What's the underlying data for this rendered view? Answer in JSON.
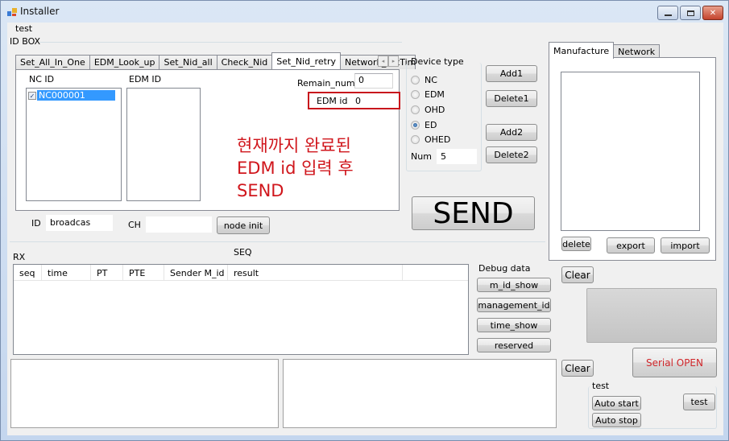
{
  "window": {
    "title": "Installer",
    "controls": {
      "minimize": "—",
      "maximize": "□",
      "close": "✕"
    }
  },
  "menu": {
    "test": "test"
  },
  "id_box": {
    "label": "ID BOX",
    "tabs": [
      {
        "label": "Set_All_In_One"
      },
      {
        "label": "EDM_Look_up"
      },
      {
        "label": "Set_Nid_all"
      },
      {
        "label": "Check_Nid"
      },
      {
        "label": "Set_Nid_retry",
        "active": true
      },
      {
        "label": "Network_setTime"
      }
    ],
    "tab_scroll": {
      "left": "◂",
      "right": "▸"
    },
    "nc_id_label": "NC ID",
    "edm_id_label": "EDM ID",
    "nc_list": [
      {
        "label": "NC000001",
        "checked": true,
        "selected": true
      }
    ],
    "edm_list": [],
    "remain_num_label": "Remain_num",
    "remain_num_value": "0",
    "edm_id_field_label": "EDM id",
    "edm_id_value": "0",
    "annotation": "현재까지 완료된 EDM id 입력 후 SEND",
    "annotation_lines": [
      "현재까지 완료된",
      "EDM id 입력 후",
      "SEND"
    ],
    "annotation_color": "#d0161c",
    "id_label": "ID",
    "id_value": "broadcas",
    "ch_label": "CH",
    "ch_value": "",
    "node_init": "node init"
  },
  "device_type": {
    "label": "Device type",
    "options": [
      {
        "label": "NC",
        "selected": false
      },
      {
        "label": "EDM",
        "selected": false
      },
      {
        "label": "OHD",
        "selected": false
      },
      {
        "label": "ED",
        "selected": true
      },
      {
        "label": "OHED",
        "selected": false
      }
    ],
    "num_label": "Num",
    "num_value": "5"
  },
  "buttons": {
    "add1": "Add1",
    "delete1": "Delete1",
    "add2": "Add2",
    "delete2": "Delete2",
    "send": "SEND"
  },
  "rx": {
    "label": "RX",
    "seq_label": "SEQ",
    "columns": [
      "seq",
      "time",
      "PT",
      "PTE",
      "Sender M_id",
      "result",
      ""
    ],
    "rows": []
  },
  "debug": {
    "label": "Debug data",
    "buttons": [
      "m_id_show",
      "management_id",
      "time_show",
      "reserved"
    ]
  },
  "right_panel": {
    "tabs": [
      {
        "label": "Manufacture",
        "active": true
      },
      {
        "label": "Network"
      }
    ],
    "delete": "delete",
    "export": "export",
    "import": "import",
    "clear1": "Clear",
    "clear2": "Clear",
    "serial_open": "Serial OPEN",
    "serial_open_color": "#d0262a",
    "test_group_label": "test",
    "auto_start": "Auto start",
    "auto_stop": "Auto stop",
    "test_button": "test"
  },
  "outline_color": "#c8161c"
}
